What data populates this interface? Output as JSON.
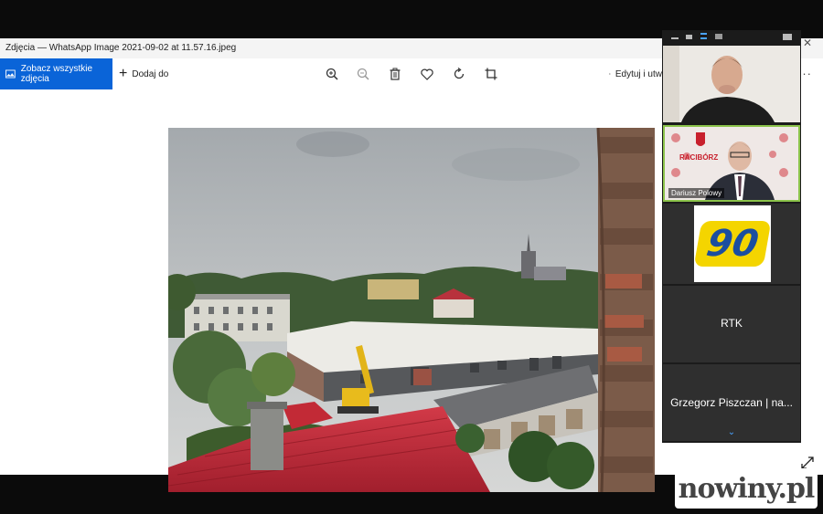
{
  "window": {
    "title": "Zdjęcia — WhatsApp Image 2021-09-02 at 11.57.16.jpeg"
  },
  "toolbar": {
    "see_all_label": "Zobacz wszystkie zdjęcia",
    "add_to_label": "Dodaj do",
    "edit_label": "Edytuj i utw",
    "more_label": "···"
  },
  "meeting": {
    "participants": [
      {
        "name": "",
        "type": "video"
      },
      {
        "name": "Dariusz Polowy",
        "type": "video",
        "background_text": "RACIBÓRZ"
      },
      {
        "name": "",
        "type": "logo",
        "logo_text": "90"
      },
      {
        "name": "RTK",
        "type": "name"
      },
      {
        "name": "Grzegorz Piszczan | na...",
        "type": "name"
      }
    ],
    "active_speaker_color": "#8bc34a"
  },
  "watermark": {
    "text": "nowiny.pl"
  },
  "colors": {
    "accent": "#0a64d8",
    "roof": "#c8283a"
  }
}
